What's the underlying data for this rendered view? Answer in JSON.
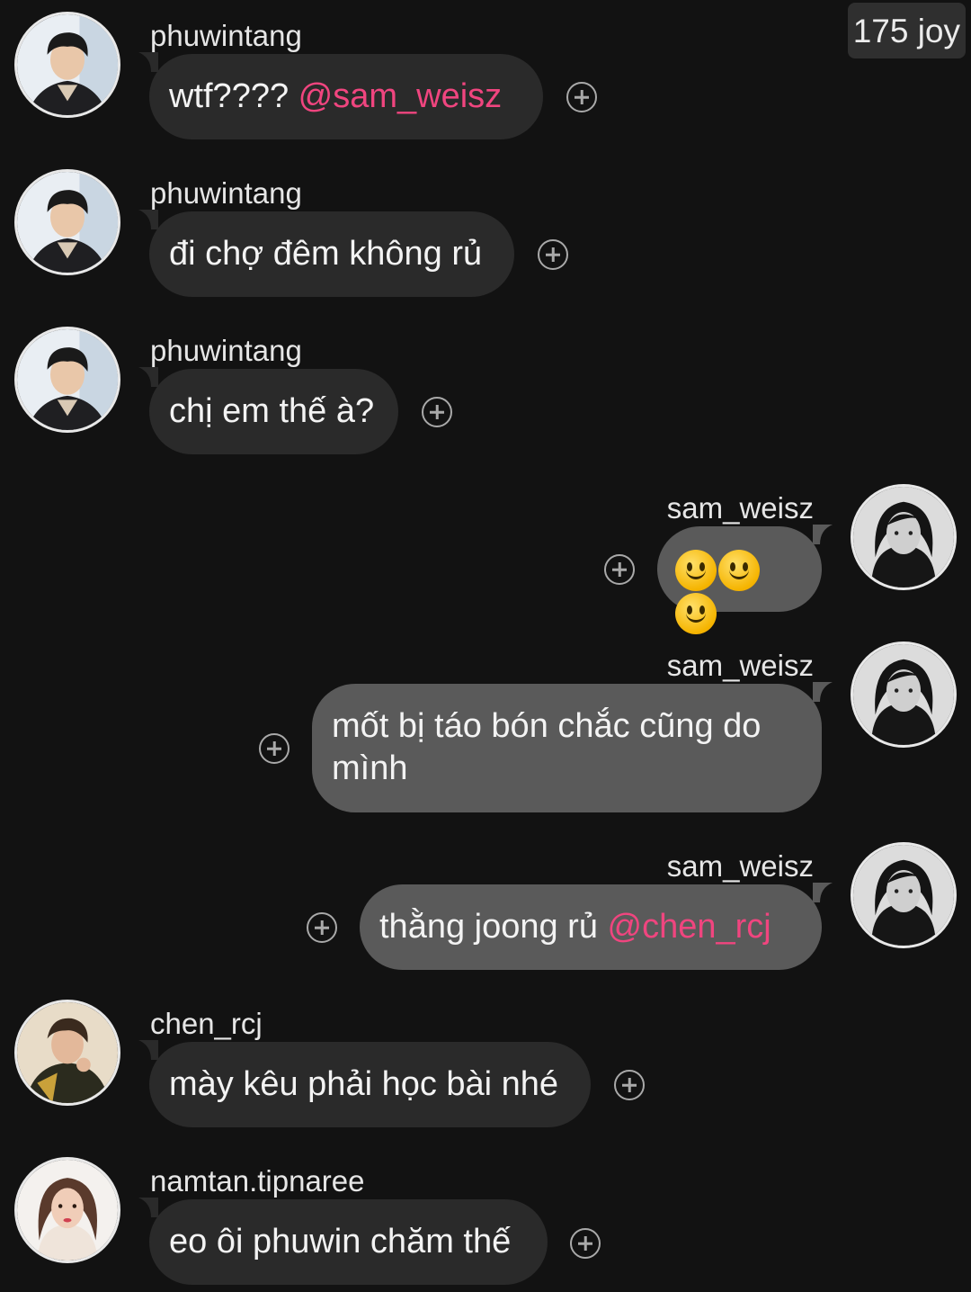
{
  "badge": {
    "text": "175 joy"
  },
  "messages": [
    {
      "username": "phuwintang",
      "text": "wtf???? ",
      "mention": "@sam_weisz",
      "avatar_icon": "avatar-phuwintang-icon"
    },
    {
      "username": "phuwintang",
      "text": "đi chợ đêm không rủ",
      "avatar_icon": "avatar-phuwintang-icon"
    },
    {
      "username": "phuwintang",
      "text": "chị em thế à?",
      "avatar_icon": "avatar-phuwintang-icon"
    },
    {
      "username": "sam_weisz",
      "text": "🙂🙂🙂",
      "avatar_icon": "avatar-sam-weisz-icon"
    },
    {
      "username": "sam_weisz",
      "text": "mốt bị táo bón chắc cũng do mình",
      "avatar_icon": "avatar-sam-weisz-icon"
    },
    {
      "username": "sam_weisz",
      "text": "thằng joong rủ ",
      "mention": "@chen_rcj",
      "avatar_icon": "avatar-sam-weisz-icon"
    },
    {
      "username": "chen_rcj",
      "text": "mày kêu phải học bài nhé",
      "avatar_icon": "avatar-chen-rcj-icon"
    },
    {
      "username": "namtan.tipnaree",
      "text": "eo ôi phuwin chăm thế",
      "avatar_icon": "avatar-namtan-icon"
    }
  ],
  "react_icon": "add-reaction-icon",
  "colors": {
    "background": "#121212",
    "bubble_left": "#2a2a2a",
    "bubble_right": "#5a5a5a",
    "mention": "#f0457f"
  }
}
